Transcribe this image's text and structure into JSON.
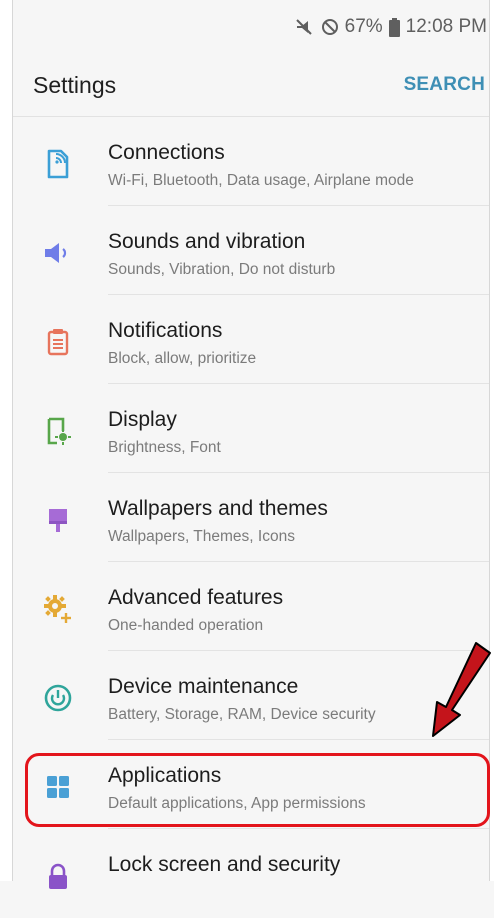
{
  "status_bar": {
    "battery_percent": "67%",
    "time": "12:08 PM",
    "icons": [
      "mute-icon",
      "do-not-disturb-icon",
      "battery-icon"
    ]
  },
  "header": {
    "title": "Settings",
    "search_label": "SEARCH"
  },
  "colors": {
    "accent": "#3e8fb5",
    "highlight": "#e3141b",
    "arrow": "#c4141b"
  },
  "settings_items": [
    {
      "title": "Connections",
      "subtitle": "Wi-Fi, Bluetooth, Data usage, Airplane mode",
      "icon": "connections-icon",
      "color": "#3b9fd6"
    },
    {
      "title": "Sounds and vibration",
      "subtitle": "Sounds, Vibration, Do not disturb",
      "icon": "sound-icon",
      "color": "#6f7de8"
    },
    {
      "title": "Notifications",
      "subtitle": "Block, allow, prioritize",
      "icon": "notifications-icon",
      "color": "#e7745c"
    },
    {
      "title": "Display",
      "subtitle": "Brightness, Font",
      "icon": "display-icon",
      "color": "#58a64a"
    },
    {
      "title": "Wallpapers and themes",
      "subtitle": "Wallpapers, Themes, Icons",
      "icon": "wallpaper-icon",
      "color": "#a66bd6"
    },
    {
      "title": "Advanced features",
      "subtitle": "One-handed operation",
      "icon": "advanced-features-icon",
      "color": "#e4a935"
    },
    {
      "title": "Device maintenance",
      "subtitle": "Battery, Storage, RAM, Device security",
      "icon": "device-maintenance-icon",
      "color": "#2fa59b"
    },
    {
      "title": "Applications",
      "subtitle": "Default applications, App permissions",
      "icon": "applications-icon",
      "color": "#4aa0d5"
    },
    {
      "title": "Lock screen and security",
      "subtitle": "",
      "icon": "lock-icon",
      "color": "#8a53c8"
    }
  ]
}
